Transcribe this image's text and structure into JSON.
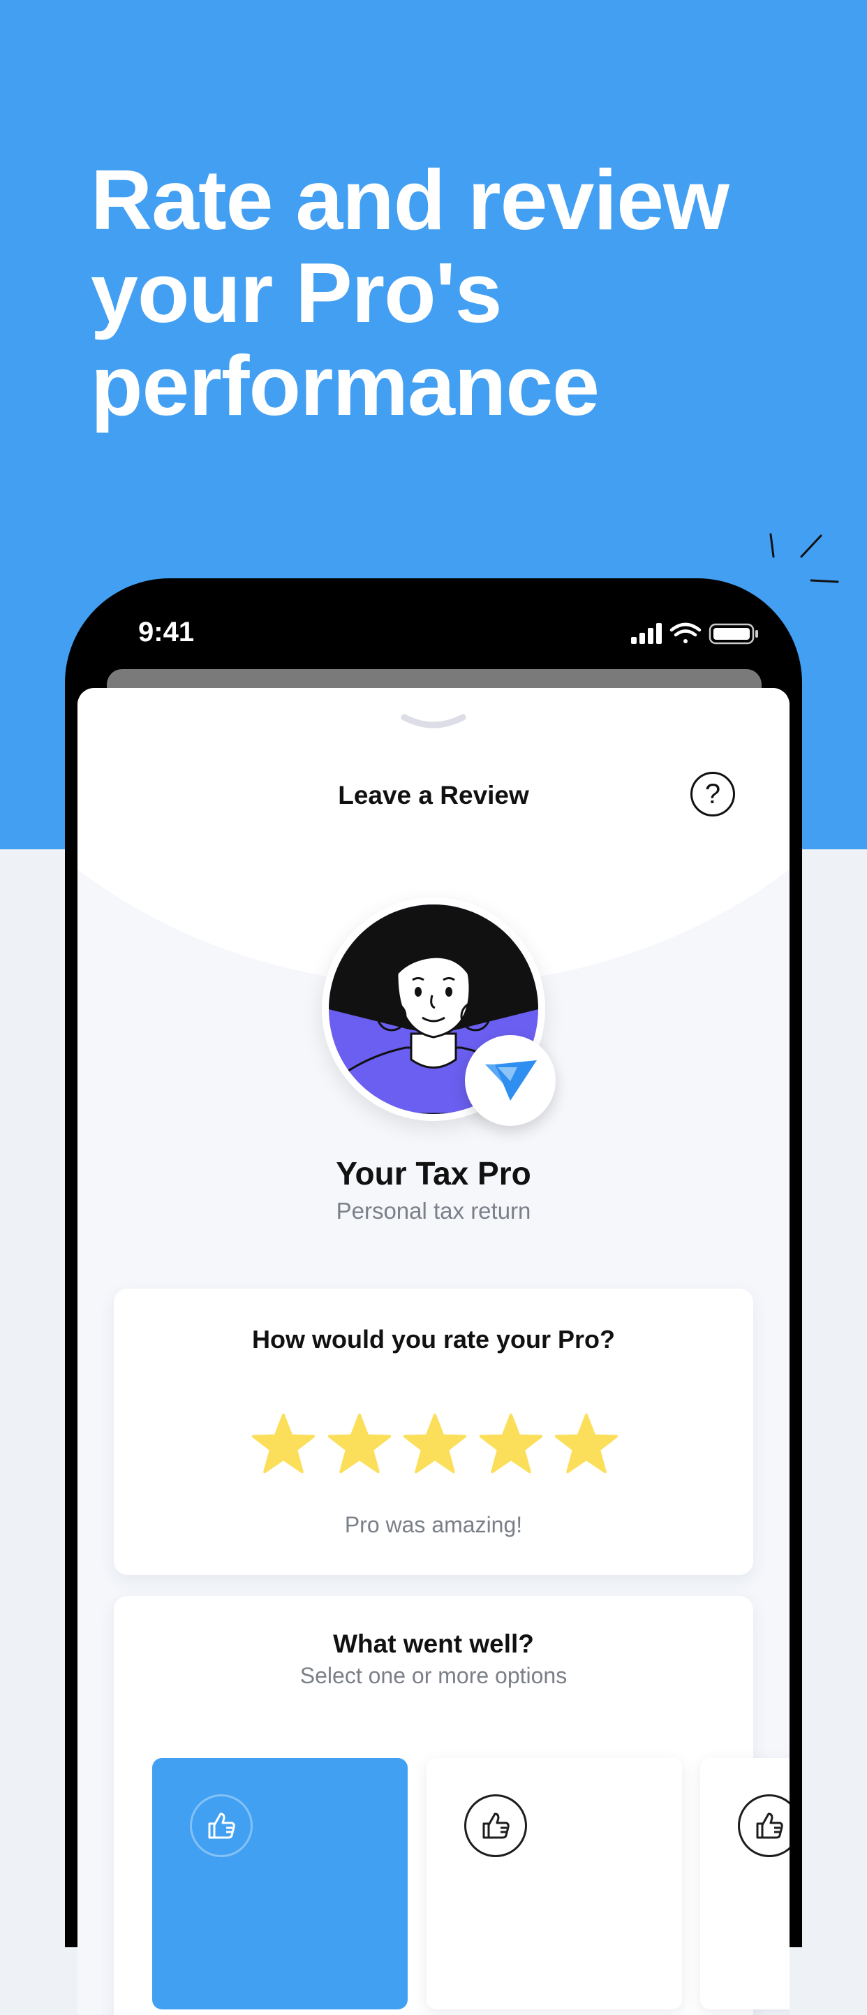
{
  "headline": "Rate and review your Pro's performance",
  "status_bar": {
    "time": "9:41"
  },
  "screen": {
    "title": "Leave a Review",
    "help_label": "?",
    "pro": {
      "name": "Your Tax Pro",
      "subtitle": "Personal tax return"
    },
    "rating": {
      "question": "How would you rate your Pro?",
      "stars_filled": 5,
      "stars_total": 5,
      "result_label": "Pro was amazing!"
    },
    "went_well": {
      "title": "What went well?",
      "subtitle": "Select one or more options",
      "options_visible": 3,
      "selected_index": 0
    }
  },
  "colors": {
    "hero_blue": "#429ff2",
    "star_yellow": "#fbdf5a",
    "avatar_purple": "#6a5ff0",
    "selected_option": "#42a0f3"
  },
  "icons": [
    "question-mark-icon",
    "thumbs-up-icon",
    "check-badge-icon",
    "signal-icon",
    "wifi-icon",
    "battery-icon",
    "star-icon"
  ]
}
